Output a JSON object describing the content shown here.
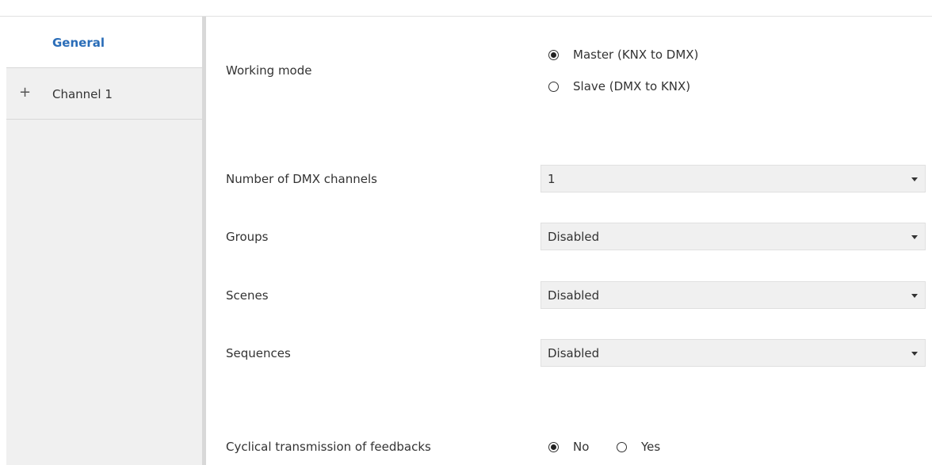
{
  "sidebar": {
    "items": [
      {
        "label": "General"
      },
      {
        "label": "Channel 1",
        "prefix": "+"
      }
    ]
  },
  "params": {
    "working_mode": {
      "label": "Working mode",
      "options": [
        "Master (KNX to DMX)",
        "Slave (DMX to KNX)"
      ],
      "selected": "Master (KNX to DMX)"
    },
    "dmx_channels": {
      "label": "Number of DMX channels",
      "value": "1"
    },
    "groups": {
      "label": "Groups",
      "value": "Disabled"
    },
    "scenes": {
      "label": "Scenes",
      "value": "Disabled"
    },
    "sequences": {
      "label": "Sequences",
      "value": "Disabled"
    },
    "cyclical": {
      "label": "Cyclical transmission of feedbacks",
      "options": [
        "No",
        "Yes"
      ],
      "selected": "No"
    }
  },
  "colors": {
    "accent": "#2a6db8",
    "sidebar_bg": "#f0f0f0",
    "select_bg": "#f0f0f0"
  }
}
